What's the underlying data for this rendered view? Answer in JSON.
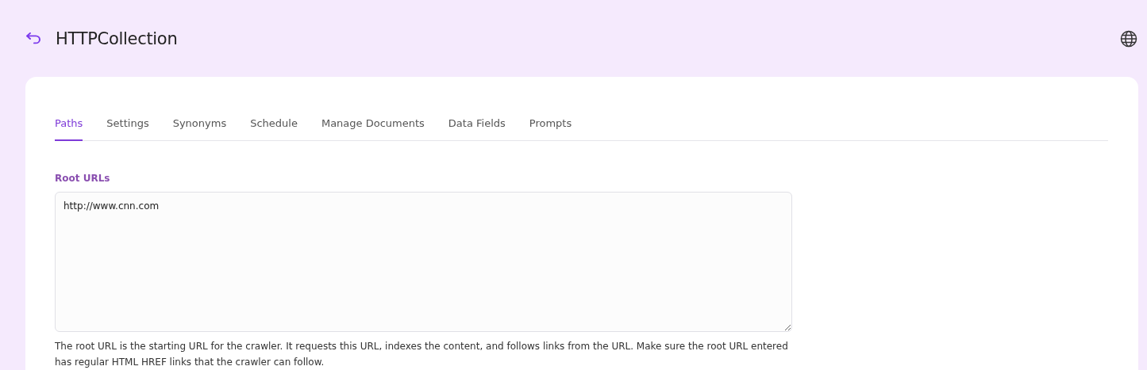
{
  "header": {
    "title": "HTTPCollection"
  },
  "tabs": [
    {
      "label": "Paths",
      "selected": true
    },
    {
      "label": "Settings",
      "selected": false
    },
    {
      "label": "Synonyms",
      "selected": false
    },
    {
      "label": "Schedule",
      "selected": false
    },
    {
      "label": "Manage Documents",
      "selected": false
    },
    {
      "label": "Data Fields",
      "selected": false
    },
    {
      "label": "Prompts",
      "selected": false
    }
  ],
  "root_urls": {
    "label": "Root URLs",
    "value": "http://www.cnn.com",
    "help": "The root URL is the starting URL for the crawler. It requests this URL, indexes the content, and follows links from the URL. Make sure the root URL entered has regular HTML HREF links that the crawler can follow."
  }
}
